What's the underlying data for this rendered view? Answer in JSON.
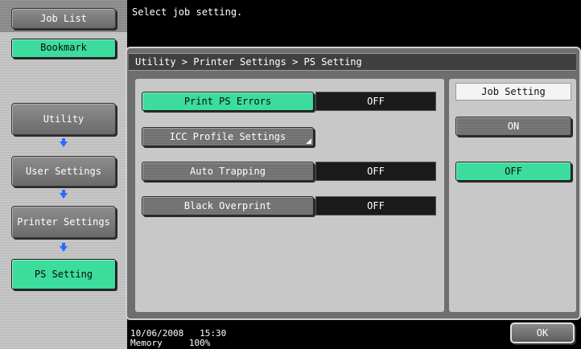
{
  "message": "Select job setting.",
  "breadcrumb": "Utility > Printer Settings > PS Setting",
  "sidebar": {
    "job_list": "Job List",
    "bookmark": "Bookmark",
    "path": [
      {
        "label": "Utility"
      },
      {
        "label": "User Settings"
      },
      {
        "label": "Printer Settings"
      },
      {
        "label": "PS Setting"
      }
    ]
  },
  "settings": [
    {
      "label": "Print PS Errors",
      "value": "OFF",
      "selected": true
    },
    {
      "label": "ICC Profile Settings"
    },
    {
      "label": "Auto Trapping",
      "value": "OFF"
    },
    {
      "label": "Black Overprint",
      "value": "OFF"
    }
  ],
  "job_setting": {
    "header": "Job Setting",
    "on": "ON",
    "off": "OFF",
    "selected": "OFF"
  },
  "status": {
    "date": "10/06/2008",
    "time": "15:30",
    "memory_label": "Memory",
    "memory_value": "100%"
  },
  "ok_label": "OK",
  "colors": {
    "selected_green": "#3cdc9c",
    "arrow_blue": "#2a6bff"
  }
}
